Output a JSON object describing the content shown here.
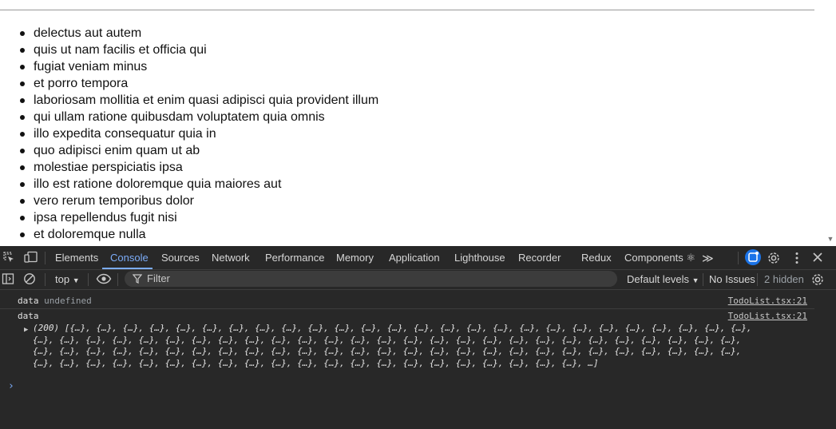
{
  "page": {
    "todos": [
      "delectus aut autem",
      "quis ut nam facilis et officia qui",
      "fugiat veniam minus",
      "et porro tempora",
      "laboriosam mollitia et enim quasi adipisci quia provident illum",
      "qui ullam ratione quibusdam voluptatem quia omnis",
      "illo expedita consequatur quia in",
      "quo adipisci enim quam ut ab",
      "molestiae perspiciatis ipsa",
      "illo est ratione doloremque quia maiores aut",
      "vero rerum temporibus dolor",
      "ipsa repellendus fugit nisi",
      "et doloremque nulla"
    ]
  },
  "devtools": {
    "tabs": [
      {
        "label": "Elements",
        "active": false
      },
      {
        "label": "Console",
        "active": true
      },
      {
        "label": "Sources",
        "active": false
      },
      {
        "label": "Network",
        "active": false
      },
      {
        "label": "Performance",
        "active": false
      },
      {
        "label": "Memory",
        "active": false
      },
      {
        "label": "Application",
        "active": false
      },
      {
        "label": "Lighthouse",
        "active": false
      },
      {
        "label": "Recorder",
        "active": false
      },
      {
        "label": "Redux",
        "active": false
      },
      {
        "label": "Components ⚛",
        "active": false
      }
    ],
    "more_tabs_label": "≫",
    "filterbar": {
      "context": "top",
      "filter_placeholder": "Filter",
      "levels": "Default levels",
      "issues": "No Issues",
      "hidden": "2 hidden"
    },
    "console": {
      "messages": [
        {
          "label": "data",
          "value": "undefined",
          "source": "TodoList.tsx:21"
        },
        {
          "label": "data",
          "value": "",
          "source": "TodoList.tsx:21"
        }
      ],
      "array_lines": [
        "(200) [{…}, {…}, {…}, {…}, {…}, {…}, {…}, {…}, {…}, {…}, {…}, {…}, {…}, {…}, {…}, {…}, {…}, {…}, {…}, {…}, {…}, {…}, {…}, {…}, {…}, {…},",
        "{…}, {…}, {…}, {…}, {…}, {…}, {…}, {…}, {…}, {…}, {…}, {…}, {…}, {…}, {…}, {…}, {…}, {…}, {…}, {…}, {…}, {…}, {…}, {…}, {…}, {…}, {…},",
        "{…}, {…}, {…}, {…}, {…}, {…}, {…}, {…}, {…}, {…}, {…}, {…}, {…}, {…}, {…}, {…}, {…}, {…}, {…}, {…}, {…}, {…}, {…}, {…}, {…}, {…}, {…},",
        "{…}, {…}, {…}, {…}, {…}, {…}, {…}, {…}, {…}, {…}, {…}, {…}, {…}, {…}, {…}, {…}, {…}, {…}, {…}, {…}, {…}, …]"
      ]
    },
    "colors": {
      "accent": "#7cacf8",
      "panel_bg": "#282828"
    }
  }
}
